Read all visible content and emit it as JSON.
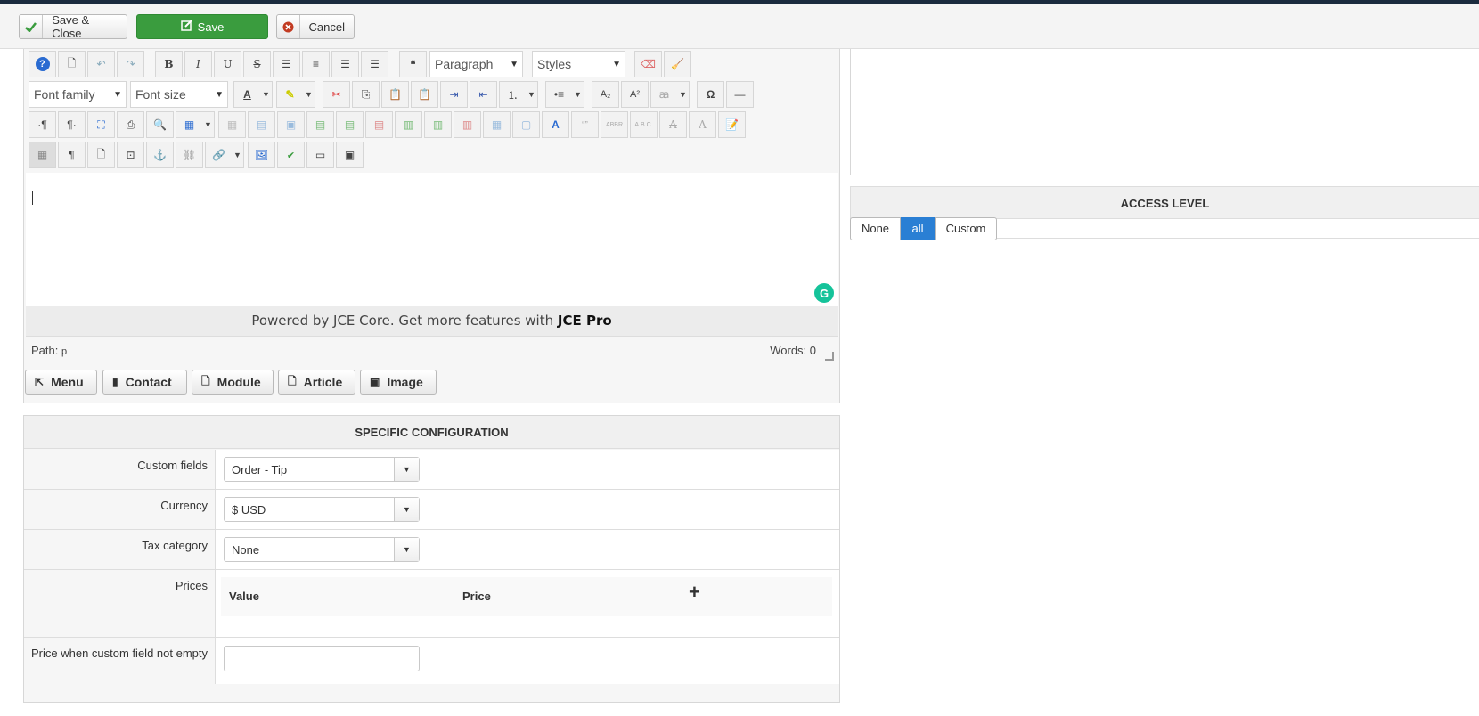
{
  "toolbar": {
    "save_close": "Save & Close",
    "save": "Save",
    "cancel": "Cancel"
  },
  "editor": {
    "format_select": "Paragraph",
    "styles_select": "Styles",
    "font_family": "Font family",
    "font_size": "Font size",
    "powered_prefix": "Powered by JCE Core. Get more features with ",
    "powered_brand": "JCE Pro",
    "path_label": "Path:",
    "path_value": "p",
    "words": "Words: 0",
    "grammarly": "G"
  },
  "extra_buttons": [
    "Menu",
    "Contact",
    "Module",
    "Article",
    "Image"
  ],
  "config": {
    "title": "SPECIFIC CONFIGURATION",
    "custom_fields_label": "Custom fields",
    "custom_fields_value": "Order - Tip",
    "currency_label": "Currency",
    "currency_value": "$ USD",
    "tax_label": "Tax category",
    "tax_value": "None",
    "prices_label": "Prices",
    "prices_col_value": "Value",
    "prices_col_price": "Price",
    "price_nonempty_label": "Price when custom field not empty",
    "price_nonempty_value": ""
  },
  "access": {
    "title": "ACCESS LEVEL",
    "options": [
      "None",
      "all",
      "Custom"
    ],
    "selected": "all"
  },
  "colors": {
    "save_green": "#3a9c3e",
    "active_blue": "#2a7fd4",
    "grammarly": "#15c39a"
  }
}
